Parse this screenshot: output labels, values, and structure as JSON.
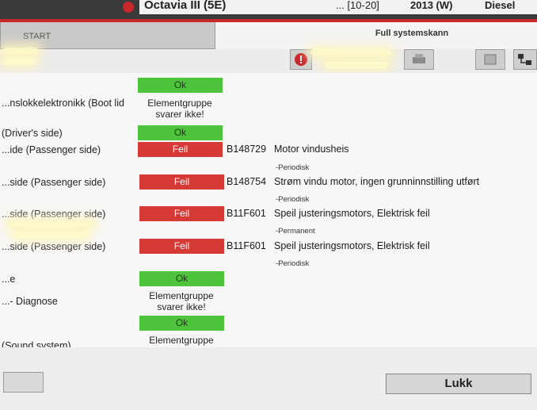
{
  "header": {
    "vehicle_model": "Octavia III (5E)",
    "field_2": "... [10-20]",
    "field_3": "2013 (W)",
    "field_4": "Diesel"
  },
  "tabs": {
    "start_label": "START"
  },
  "view": {
    "title": "Full systemskann"
  },
  "toolbar": {
    "icons": [
      "warning-icon",
      "print-icon",
      "document-icon",
      "network-icon"
    ]
  },
  "rows": [
    {
      "name": "...nslokkelektronikk (Boot lid",
      "status": "Ok"
    },
    {
      "note": "Elementgruppe\nsvarer ikke!"
    },
    {
      "name": "(Driver's side)",
      "status": "Ok"
    },
    {
      "name": "...ide (Passenger side)",
      "status": "Feil",
      "code": "B148729",
      "text": "Motor vindusheis",
      "freq": "-Periodisk"
    },
    {
      "name": "...side (Passenger side)",
      "status": "Feil",
      "code": "B148754",
      "text": "Strøm vindu motor, ingen grunninnstilling utført",
      "freq": "-Periodisk"
    },
    {
      "name": "...side (Passenger side)",
      "status": "Feil",
      "code": "B11F601",
      "text": "Speil justeringsmotors, Elektrisk feil",
      "freq": "-Permanent"
    },
    {
      "name": "...side (Passenger side)",
      "status": "Feil",
      "code": "B11F601",
      "text": "Speil justeringsmotors, Elektrisk feil",
      "freq": "-Periodisk"
    },
    {
      "name": "...e",
      "status": "Ok"
    },
    {
      "name": "...- Diagnose",
      "note": "Elementgruppe\nsvarer ikke!"
    },
    {
      "status": "Ok"
    },
    {
      "name": "(Sound system)",
      "note": "Elementgruppe\nsvarer ikke!"
    }
  ],
  "footer": {
    "close_label": "Lukk"
  },
  "colors": {
    "ok": "#4ec43c",
    "error": "#d63a36",
    "accent_red": "#c8282c"
  }
}
